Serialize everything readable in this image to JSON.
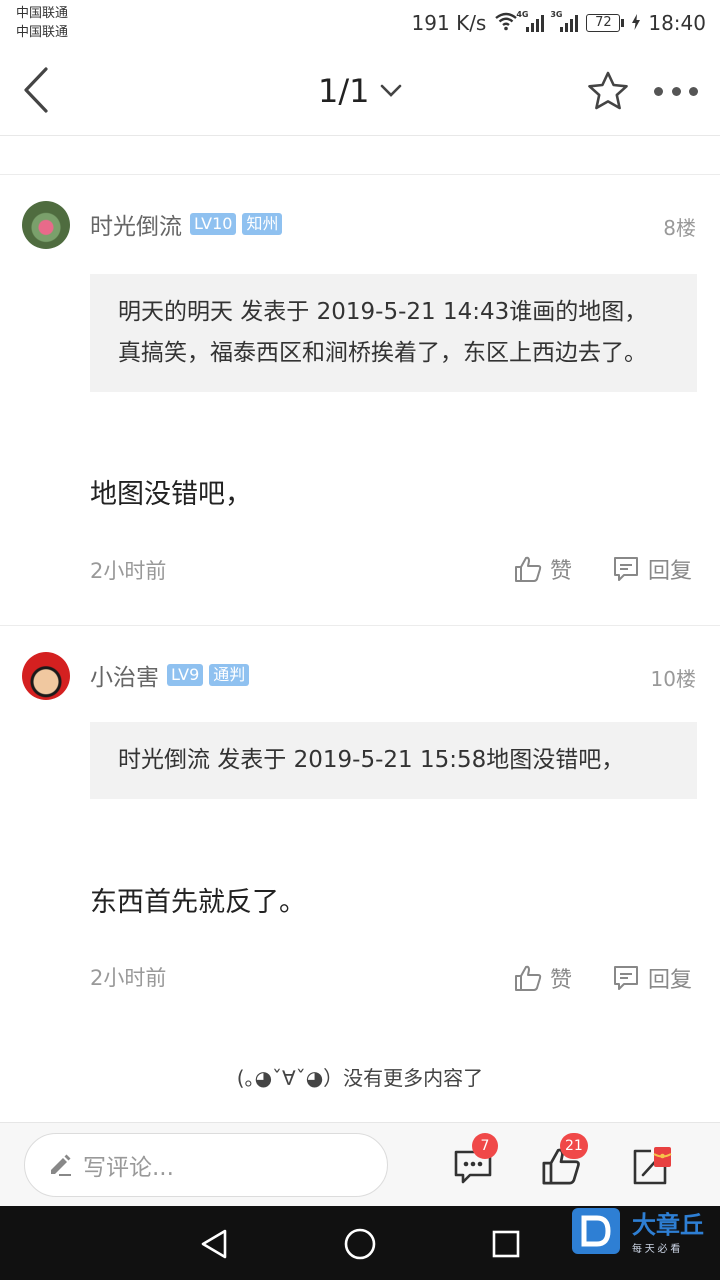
{
  "status_bar": {
    "carrier_1": "中国联通",
    "carrier_2": "中国联通",
    "net_speed": "191 K/s",
    "net_tag_1": "4G",
    "net_tag_2": "3G",
    "battery": "72",
    "time": "18:40"
  },
  "nav": {
    "page_indicator": "1/1",
    "icons": [
      "back-icon",
      "chevron-down-icon",
      "star-icon",
      "more-icon"
    ]
  },
  "posts": [
    {
      "author": "时光倒流",
      "level": "LV10",
      "role": "知州",
      "floor": "8楼",
      "quote": "明天的明天 发表于 2019-5-21 14:43谁画的地图，真搞笑，福泰西区和涧桥挨着了，东区上西边去了。",
      "content": "地图没错吧，",
      "time": "2小时前",
      "like_label": "赞",
      "reply_label": "回复"
    },
    {
      "author": "小治害",
      "level": "LV9",
      "role": "通判",
      "floor": "10楼",
      "quote": "时光倒流 发表于 2019-5-21 15:58地图没错吧，",
      "content": "东西首先就反了。",
      "time": "2小时前",
      "like_label": "赞",
      "reply_label": "回复"
    }
  ],
  "no_more": "(｡◕ˇ∀ˇ◕）没有更多内容了",
  "bottom_bar": {
    "comment_placeholder": "写评论...",
    "comments_count": "7",
    "likes_count": "21"
  },
  "watermark": {
    "brand": "大章丘",
    "slogan": "每 天 必 看"
  },
  "colors": {
    "badge_blue": "#8fc1f0",
    "count_red": "#f04848",
    "quote_bg": "#f2f2f2"
  }
}
